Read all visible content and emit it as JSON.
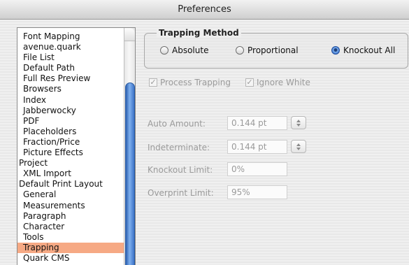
{
  "window": {
    "title": "Preferences"
  },
  "sidebar": {
    "items": [
      {
        "label": "Font Mapping",
        "level": 1
      },
      {
        "label": "avenue.quark",
        "level": 1
      },
      {
        "label": "File List",
        "level": 1
      },
      {
        "label": "Default Path",
        "level": 1
      },
      {
        "label": "Full Res Preview",
        "level": 1
      },
      {
        "label": "Browsers",
        "level": 1
      },
      {
        "label": "Index",
        "level": 1
      },
      {
        "label": "Jabberwocky",
        "level": 1
      },
      {
        "label": "PDF",
        "level": 1
      },
      {
        "label": "Placeholders",
        "level": 1
      },
      {
        "label": "Fraction/Price",
        "level": 1
      },
      {
        "label": "Picture Effects",
        "level": 1
      },
      {
        "label": "Project",
        "level": 0
      },
      {
        "label": "XML Import",
        "level": 1
      },
      {
        "label": "Default Print Layout",
        "level": 0
      },
      {
        "label": "General",
        "level": 1
      },
      {
        "label": "Measurements",
        "level": 1
      },
      {
        "label": "Paragraph",
        "level": 1
      },
      {
        "label": "Character",
        "level": 1
      },
      {
        "label": "Tools",
        "level": 1
      },
      {
        "label": "Trapping",
        "level": 1,
        "selected": true
      },
      {
        "label": "Quark CMS",
        "level": 1
      }
    ]
  },
  "trapping_method": {
    "title": "Trapping Method",
    "options": [
      "Absolute",
      "Proportional",
      "Knockout All"
    ],
    "selected": "Knockout All"
  },
  "checkboxes": {
    "process_trapping": "Process Trapping",
    "ignore_white": "Ignore White"
  },
  "fields": {
    "auto_amount": {
      "label": "Auto Amount:",
      "value": "0.144 pt"
    },
    "indeterminate": {
      "label": "Indeterminate:",
      "value": "0.144 pt"
    },
    "knockout_limit": {
      "label": "Knockout Limit:",
      "value": "0%"
    },
    "overprint_limit": {
      "label": "Overprint Limit:",
      "value": "95%"
    }
  },
  "colors": {
    "selection": "#f6a984",
    "scroll_thumb": "#3c73c8"
  }
}
